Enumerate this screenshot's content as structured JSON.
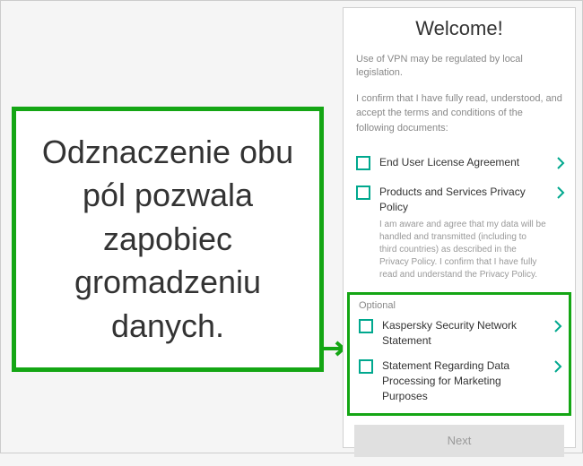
{
  "callout": {
    "text": "Odznaczenie obu pól pozwala zapobiec gromadzeniu danych."
  },
  "screen": {
    "title": "Welcome!",
    "subtitle": "Use of VPN may be regulated by local legislation.",
    "intro": "I confirm that I have fully read, understood, and accept the terms and conditions of the following documents:",
    "items": [
      {
        "label": "End User License Agreement",
        "desc": ""
      },
      {
        "label": "Products and Services Privacy Policy",
        "desc": "I am aware and agree that my data will be handled and transmitted (including to third countries) as described in the Privacy Policy. I confirm that I have fully read and understand the Privacy Policy."
      }
    ],
    "optional": {
      "label": "Optional",
      "items": [
        {
          "label": "Kaspersky Security Network Statement"
        },
        {
          "label": "Statement Regarding Data Processing for Marketing Purposes"
        }
      ]
    },
    "next": "Next"
  },
  "colors": {
    "highlight": "#14a614",
    "teal": "#00a88e"
  }
}
